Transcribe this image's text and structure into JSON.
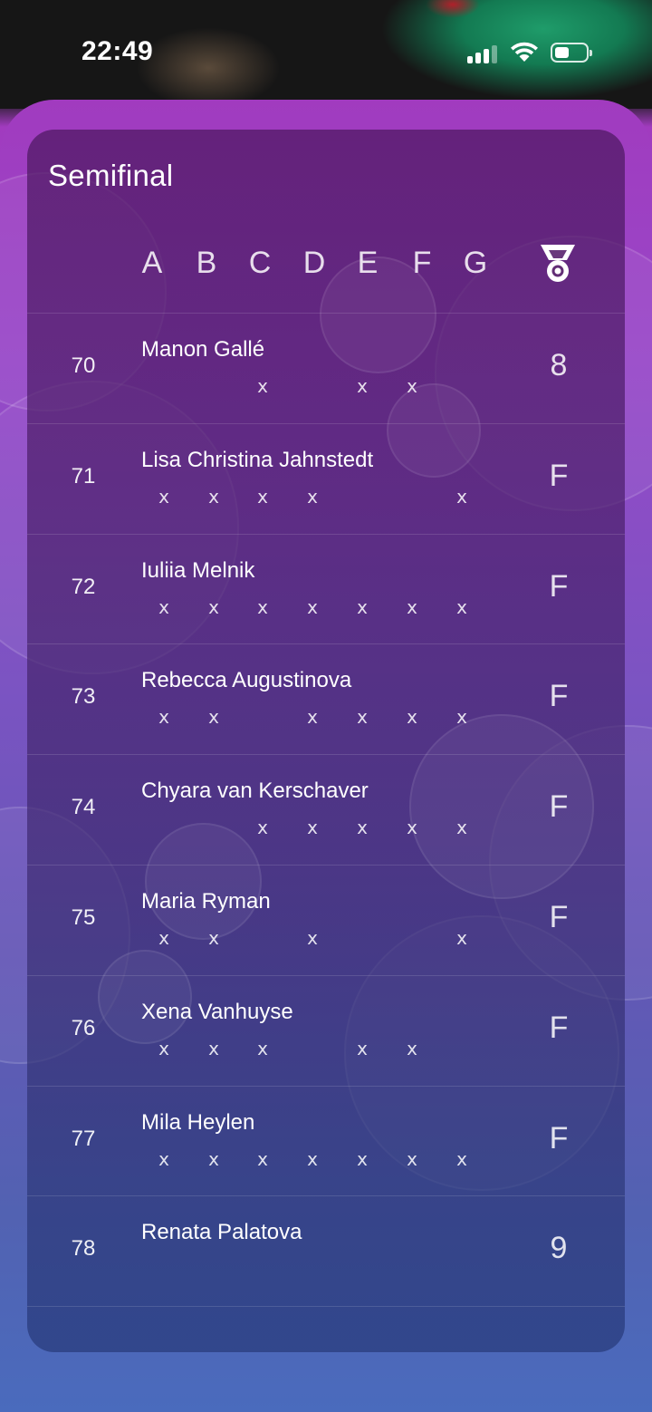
{
  "status_bar": {
    "time": "22:49",
    "signal_bars": 4,
    "signal_active": 3,
    "battery_level": 0.45
  },
  "page": {
    "title": "Semifinal",
    "columns": [
      "A",
      "B",
      "C",
      "D",
      "E",
      "F",
      "G"
    ],
    "result_icon": "medal-icon"
  },
  "rows": [
    {
      "bib": "70",
      "name": "Manon Gallé",
      "marks": [
        "",
        "",
        "x",
        "",
        "x",
        "x",
        ""
      ],
      "result": "8"
    },
    {
      "bib": "71",
      "name": "Lisa Christina Jahnstedt",
      "marks": [
        "x",
        "x",
        "x",
        "x",
        "",
        "",
        "x"
      ],
      "result": "F"
    },
    {
      "bib": "72",
      "name": "Iuliia Melnik",
      "marks": [
        "x",
        "x",
        "x",
        "x",
        "x",
        "x",
        "x"
      ],
      "result": "F"
    },
    {
      "bib": "73",
      "name": "Rebecca Augustinova",
      "marks": [
        "x",
        "x",
        "",
        "x",
        "x",
        "x",
        "x"
      ],
      "result": "F"
    },
    {
      "bib": "74",
      "name": "Chyara van Kerschaver",
      "marks": [
        "",
        "",
        "x",
        "x",
        "x",
        "x",
        "x"
      ],
      "result": "F"
    },
    {
      "bib": "75",
      "name": "Maria Ryman",
      "marks": [
        "x",
        "x",
        "",
        "x",
        "",
        "",
        "x"
      ],
      "result": "F"
    },
    {
      "bib": "76",
      "name": "Xena Vanhuyse",
      "marks": [
        "x",
        "x",
        "x",
        "",
        "x",
        "x",
        ""
      ],
      "result": "F"
    },
    {
      "bib": "77",
      "name": "Mila Heylen",
      "marks": [
        "x",
        "x",
        "x",
        "x",
        "x",
        "x",
        "x"
      ],
      "result": "F"
    },
    {
      "bib": "78",
      "name": "Renata Palatova",
      "marks": [
        "",
        "",
        "",
        "",
        "",
        "",
        ""
      ],
      "result": "9"
    }
  ]
}
